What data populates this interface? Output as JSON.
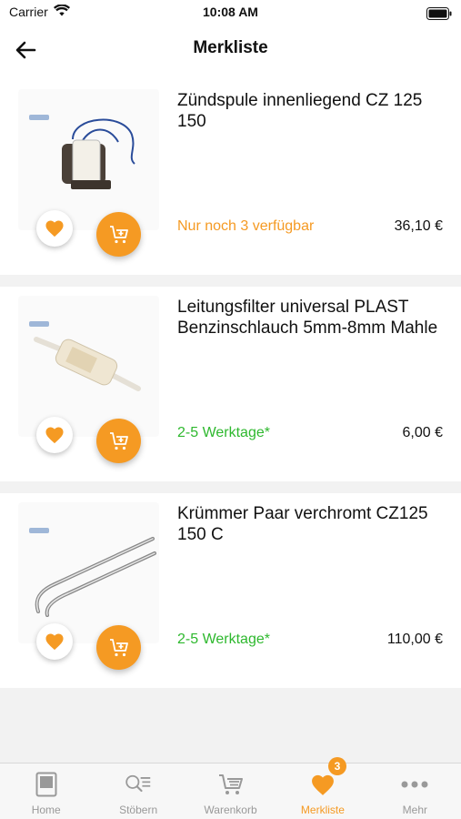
{
  "status_bar": {
    "carrier": "Carrier",
    "time": "10:08 AM"
  },
  "header": {
    "title": "Merkliste"
  },
  "colors": {
    "accent": "#f59a23",
    "in_stock": "#2eb82e"
  },
  "items": [
    {
      "name": "Zündspule innenliegend CZ 125 150",
      "availability": "Nur noch 3 verfügbar",
      "availability_color": "#f59a23",
      "price": "36,10 €"
    },
    {
      "name": "Leitungsfilter universal PLAST Benzinschlauch 5mm-8mm Mahle",
      "availability": "2-5 Werktage*",
      "availability_color": "#2eb82e",
      "price": "6,00 €"
    },
    {
      "name": "Krümmer Paar verchromt CZ125 150 C",
      "availability": "2-5 Werktage*",
      "availability_color": "#2eb82e",
      "price": "110,00 €"
    }
  ],
  "tabbar": {
    "tabs": [
      {
        "label": "Home",
        "icon": "home-icon"
      },
      {
        "label": "Stöbern",
        "icon": "browse-icon"
      },
      {
        "label": "Warenkorb",
        "icon": "cart-icon"
      },
      {
        "label": "Merkliste",
        "icon": "heart-icon",
        "badge": "3",
        "active": true
      },
      {
        "label": "Mehr",
        "icon": "more-icon"
      }
    ]
  }
}
